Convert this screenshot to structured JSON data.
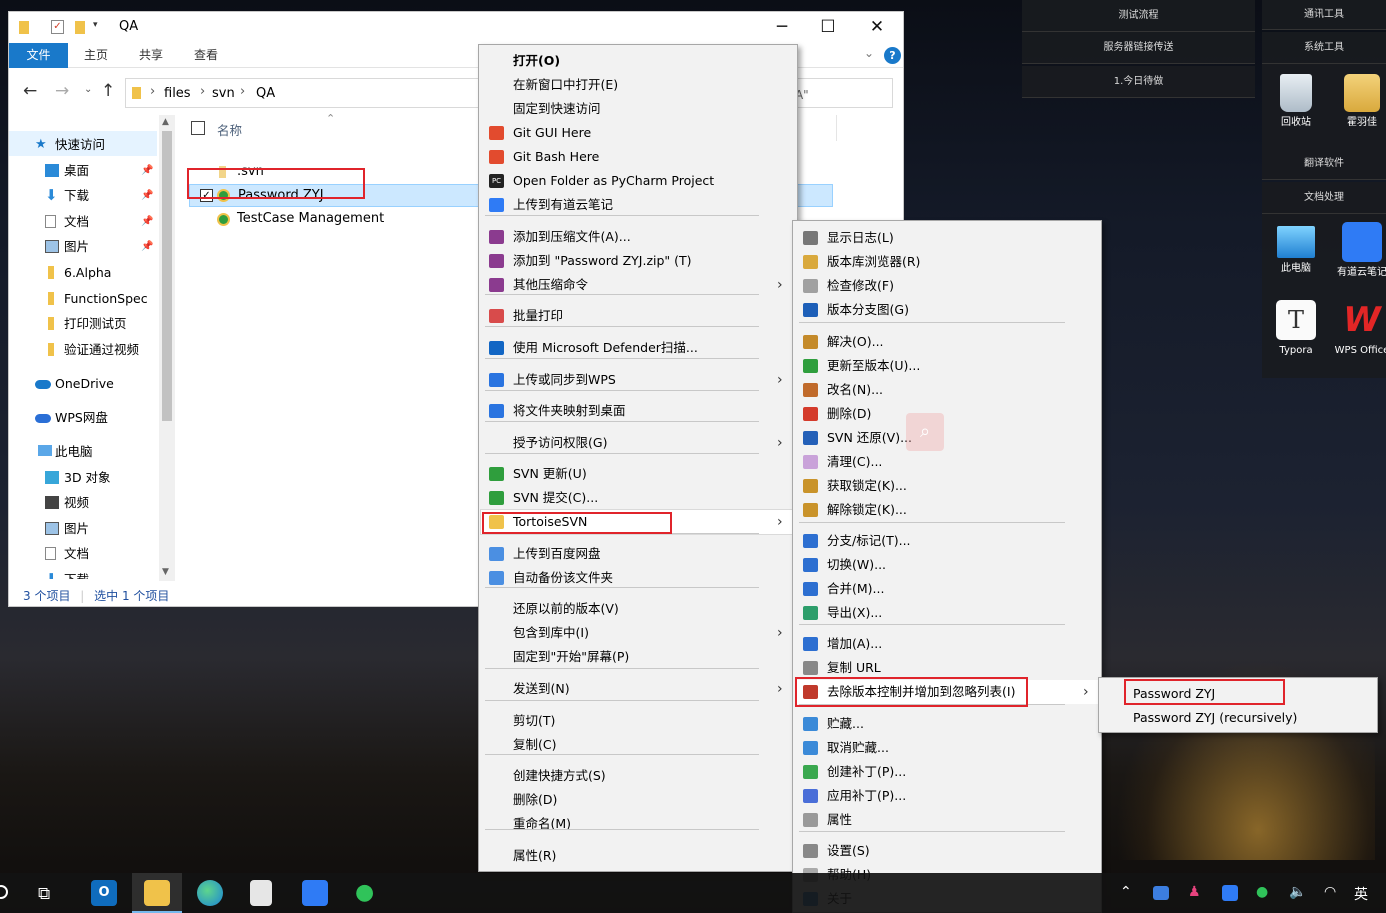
{
  "explorer": {
    "window_title": "QA",
    "ribbon_tabs": [
      "文件",
      "主页",
      "共享",
      "查看"
    ],
    "breadcrumb": [
      "files",
      "svn",
      "QA"
    ],
    "search_placeholder": "搜索\"QA\"",
    "column_header": "名称",
    "files": [
      ".svn",
      "Password ZYJ",
      "TestCase Management"
    ],
    "nav": {
      "quick_access": "快速访问",
      "quick_items": [
        "桌面",
        "下载",
        "文档",
        "图片",
        "6.Alpha",
        "FunctionSpec",
        "打印测试页",
        "验证通过视频"
      ],
      "onedrive": "OneDrive",
      "wps": "WPS网盘",
      "this_pc": "此电脑",
      "pc_items": [
        "3D 对象",
        "视频",
        "图片",
        "文档",
        "下载"
      ]
    },
    "status": {
      "count": "3 个项目",
      "selected": "选中 1 个项目"
    }
  },
  "context_menu": [
    "打开(O)",
    "在新窗口中打开(E)",
    "固定到快速访问",
    "Git GUI Here",
    "Git Bash Here",
    "Open Folder as PyCharm Project",
    "上传到有道云笔记",
    "添加到压缩文件(A)...",
    "添加到 \"Password ZYJ.zip\" (T)",
    "其他压缩命令",
    "批量打印",
    "使用 Microsoft Defender扫描...",
    "上传或同步到WPS",
    "将文件夹映射到桌面",
    "授予访问权限(G)",
    "SVN 更新(U)",
    "SVN 提交(C)...",
    "TortoiseSVN",
    "上传到百度网盘",
    "自动备份该文件夹",
    "还原以前的版本(V)",
    "包含到库中(I)",
    "固定到\"开始\"屏幕(P)",
    "发送到(N)",
    "剪切(T)",
    "复制(C)",
    "创建快捷方式(S)",
    "删除(D)",
    "重命名(M)",
    "属性(R)"
  ],
  "svn_menu": [
    "显示日志(L)",
    "版本库浏览器(R)",
    "检查修改(F)",
    "版本分支图(G)",
    "解决(O)...",
    "更新至版本(U)...",
    "改名(N)...",
    "删除(D)",
    "SVN 还原(V)...",
    "清理(C)...",
    "获取锁定(K)...",
    "解除锁定(K)...",
    "分支/标记(T)...",
    "切换(W)...",
    "合并(M)...",
    "导出(X)...",
    "增加(A)...",
    "复制 URL",
    "去除版本控制并增加到忽略列表(I)",
    "贮藏...",
    "取消贮藏...",
    "创建补丁(P)...",
    "应用补丁(P)...",
    "属性",
    "设置(S)",
    "帮助(H)",
    "关于"
  ],
  "ignore_menu": [
    "Password ZYJ",
    "Password ZYJ (recursively)"
  ],
  "desktop": {
    "widgets": [
      "测试流程",
      "服务器链接传送",
      "1.今日待做",
      "通讯工具",
      "系统工具",
      "翻译软件",
      "文档处理"
    ],
    "icons": [
      "回收站",
      "霍羽佳",
      "此电脑",
      "有道云笔记",
      "Typora",
      "WPS Office"
    ]
  },
  "taskbar": {
    "ime": "英"
  },
  "colors": {
    "accent": "#1979ca",
    "highlight": "#e0242b",
    "selection": "#cce8ff"
  }
}
